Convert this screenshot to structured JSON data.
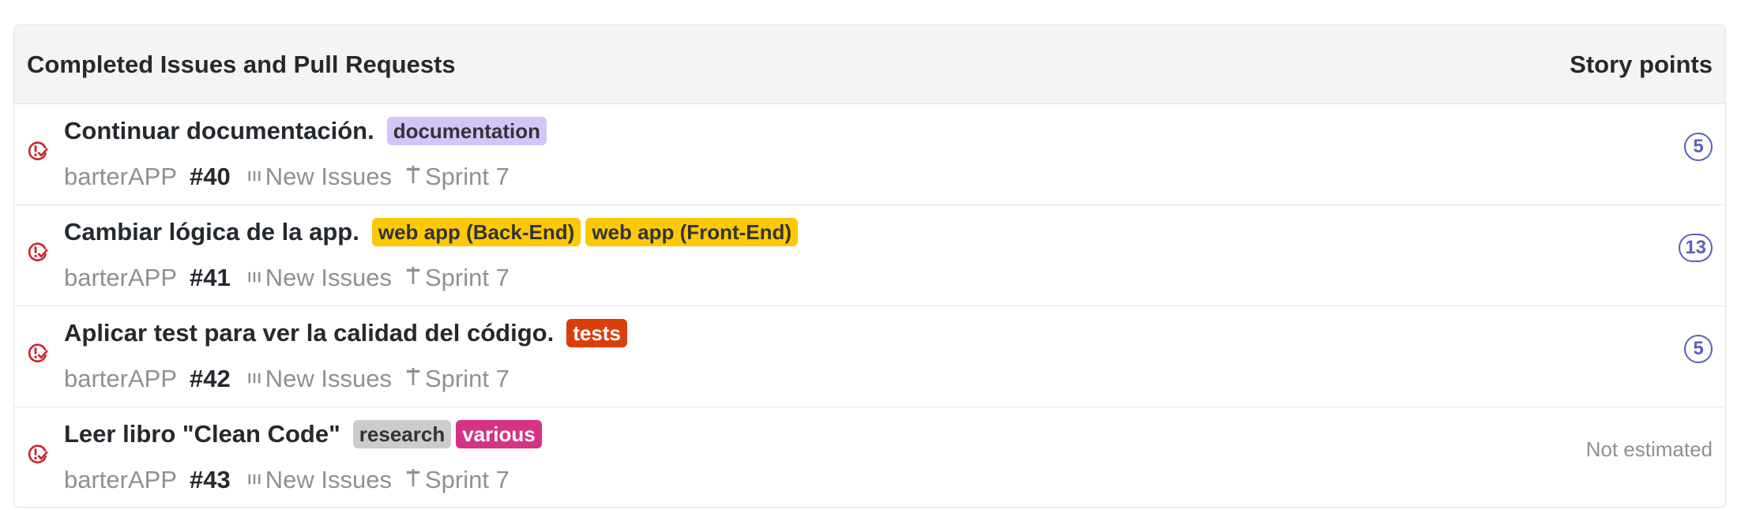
{
  "header": {
    "title": "Completed Issues and Pull Requests",
    "points_label": "Story points"
  },
  "colors": {
    "issue_icon": "#cb2431",
    "points_badge": "#5a5fbf"
  },
  "issues": [
    {
      "title": "Continuar documentación.",
      "labels": [
        {
          "text": "documentation",
          "bg": "#d4c5f9",
          "fg": "#333333"
        }
      ],
      "repo": "barterAPP",
      "number": "#40",
      "column": "New Issues",
      "milestone": "Sprint 7",
      "points": "5",
      "icon": "issue-closed-icon"
    },
    {
      "title": "Cambiar lógica de la app.",
      "labels": [
        {
          "text": "web app (Back-End)",
          "bg": "#fbca04",
          "fg": "#333333"
        },
        {
          "text": "web app (Front-End)",
          "bg": "#fbca04",
          "fg": "#333333"
        }
      ],
      "repo": "barterAPP",
      "number": "#41",
      "column": "New Issues",
      "milestone": "Sprint 7",
      "points": "13",
      "icon": "issue-closed-icon"
    },
    {
      "title": "Aplicar test para ver la calidad del código.",
      "labels": [
        {
          "text": "tests",
          "bg": "#d93f0b",
          "fg": "#ffffff"
        }
      ],
      "repo": "barterAPP",
      "number": "#42",
      "column": "New Issues",
      "milestone": "Sprint 7",
      "points": "5",
      "icon": "issue-closed-icon"
    },
    {
      "title": "Leer libro \"Clean Code\"",
      "labels": [
        {
          "text": "research",
          "bg": "#cccccc",
          "fg": "#333333"
        },
        {
          "text": "various",
          "bg": "#d63384",
          "fg": "#ffffff"
        }
      ],
      "repo": "barterAPP",
      "number": "#43",
      "column": "New Issues",
      "milestone": "Sprint 7",
      "points": null,
      "not_estimated": "Not estimated",
      "icon": "issue-closed-icon"
    }
  ]
}
